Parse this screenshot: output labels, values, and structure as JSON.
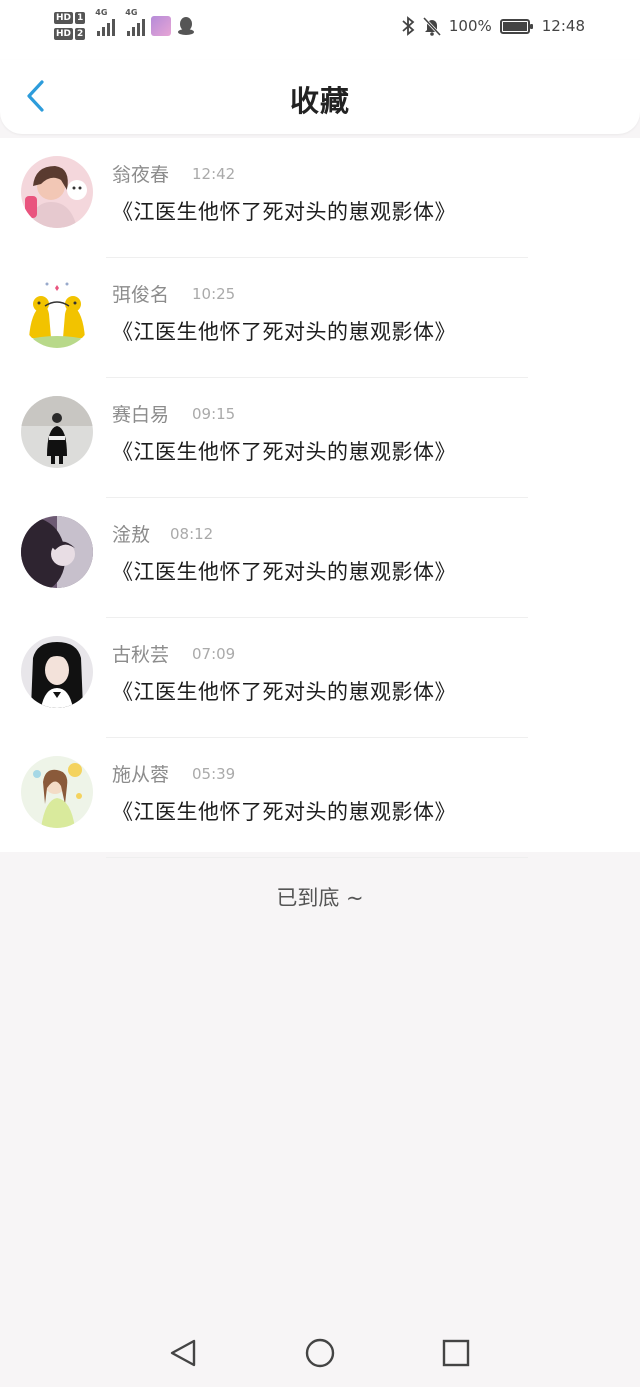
{
  "status_bar": {
    "hd1": "HD",
    "hd1_num": "1",
    "hd2": "HD",
    "hd2_num": "2",
    "network1": "4G",
    "network2": "4G",
    "battery_percent": "100%",
    "battery_level": 1.0,
    "time": "12:48",
    "icons": [
      "hd-icon",
      "signal-icon",
      "app-icon",
      "qq-icon",
      "bluetooth-icon",
      "bell-mute-icon",
      "battery-icon"
    ]
  },
  "header": {
    "title": "收藏",
    "back_icon": "chevron-left-icon",
    "accent": "#2d9cdb"
  },
  "favorites": [
    {
      "name": "翁夜春",
      "time": "12:42",
      "title": "《江医生他怀了死对头的崽观影体》",
      "avatar": "avatar-icon"
    },
    {
      "name": "弭俊名",
      "time": "10:25",
      "title": "《江医生他怀了死对头的崽观影体》",
      "avatar": "avatar-icon"
    },
    {
      "name": "赛白易",
      "time": "09:15",
      "title": "《江医生他怀了死对头的崽观影体》",
      "avatar": "avatar-icon"
    },
    {
      "name": "淦敖",
      "time": "08:12",
      "title": "《江医生他怀了死对头的崽观影体》",
      "avatar": "avatar-icon"
    },
    {
      "name": "古秋芸",
      "time": "07:09",
      "title": "《江医生他怀了死对头的崽观影体》",
      "avatar": "avatar-icon"
    },
    {
      "name": "施从蓉",
      "time": "05:39",
      "title": "《江医生他怀了死对头的崽观影体》",
      "avatar": "avatar-icon"
    }
  ],
  "list_end": "已到底 ~",
  "nav_bar": {
    "icons": [
      "back-triangle-icon",
      "home-circle-icon",
      "recents-square-icon"
    ]
  }
}
